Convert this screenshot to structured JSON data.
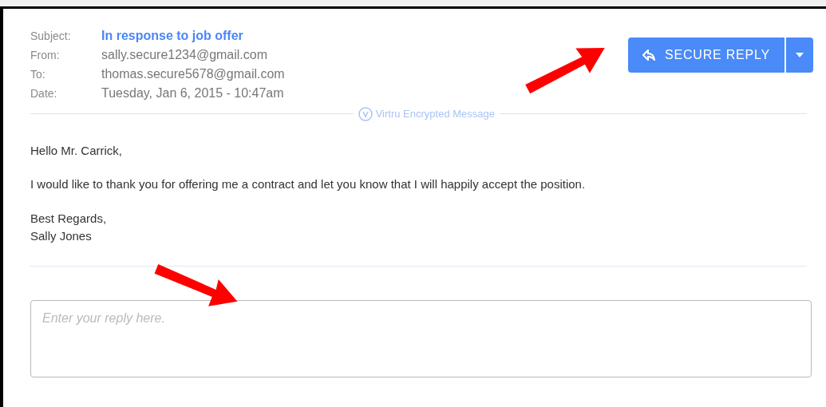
{
  "header": {
    "fields": [
      {
        "label": "Subject:",
        "value": "In response to job offer",
        "kind": "subject"
      },
      {
        "label": "From:",
        "value": "sally.secure1234@gmail.com",
        "kind": "plain"
      },
      {
        "label": "To:",
        "value": "thomas.secure5678@gmail.com",
        "kind": "plain"
      },
      {
        "label": "Date:",
        "value": "Tuesday, Jan 6, 2015 - 10:47am",
        "kind": "plain"
      }
    ]
  },
  "reply_button": {
    "label": "SECURE REPLY"
  },
  "divider_label": "Virtru Encrypted Message",
  "body": [
    "Hello Mr. Carrick,",
    "I would like to thank you for offering me a contract and let you know that I will happily accept the position."
  ],
  "signature": [
    "Best Regards,",
    "Sally Jones"
  ],
  "reply": {
    "placeholder": "Enter your reply here."
  }
}
